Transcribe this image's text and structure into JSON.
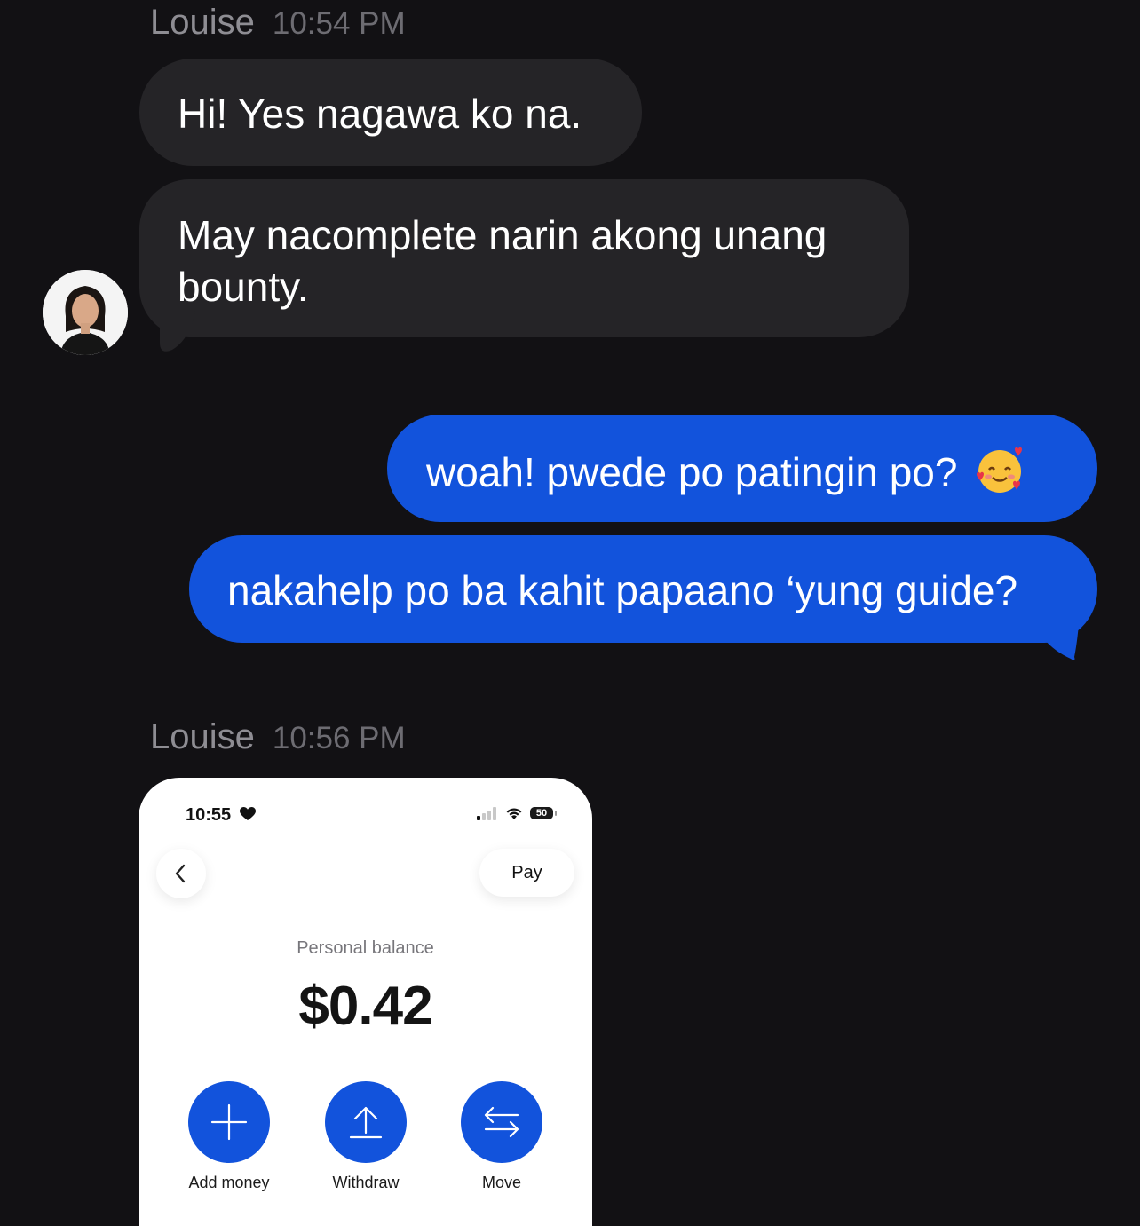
{
  "messages": [
    {
      "sender": "Louise",
      "time": "10:54 PM"
    },
    {
      "text": "Hi! Yes nagawa ko na."
    },
    {
      "text_line1": "May nacomplete narin akong unang",
      "text_line2": "bounty."
    },
    {
      "text": "woah! pwede po patingin po?",
      "emoji": "smiling-face-with-hearts"
    },
    {
      "text": "nakahelp po ba kahit papaano ‘yung guide?"
    },
    {
      "sender": "Louise",
      "time": "10:56 PM"
    }
  ],
  "colors": {
    "incoming": "#252427",
    "outgoing": "#1253dc",
    "background": "#121114"
  },
  "screenshot": {
    "status_time": "10:55",
    "battery": "50",
    "pay_label": "Pay",
    "balance_label": "Personal balance",
    "balance_amount": "$0.42",
    "actions": [
      {
        "label": "Add money",
        "icon": "plus-icon"
      },
      {
        "label": "Withdraw",
        "icon": "upload-icon"
      },
      {
        "label": "Move",
        "icon": "swap-arrows-icon"
      }
    ]
  }
}
